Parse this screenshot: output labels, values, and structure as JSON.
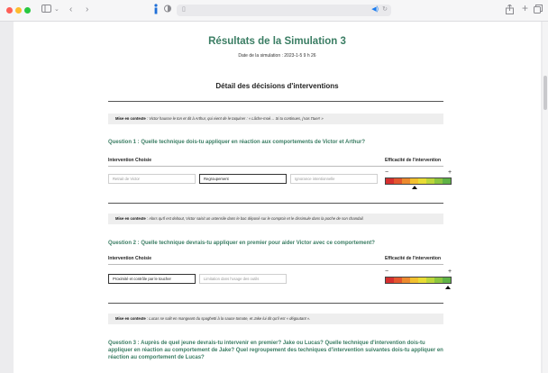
{
  "browser": {
    "url": "",
    "icons": {
      "sidebar": "sidebar-icon",
      "back": "chevron-left-icon",
      "forward": "chevron-right-icon",
      "share": "share-icon",
      "new_tab": "plus-icon",
      "tabs": "tabs-icon"
    }
  },
  "page": {
    "title": "Résultats de la Simulation 3",
    "date": "Date de la simulation : 2023-1-5 9 h 26",
    "section_title": "Détail des décisions d'interventions"
  },
  "labels": {
    "chosen_intervention": "Intervention Choisie",
    "efficacy": "Efficacité de l'intervention",
    "minus": "−",
    "plus": "+"
  },
  "questions": [
    {
      "context_label": "Mise en contexte",
      "context_text": " : Victor hausse le ton et dit à Arthur, qui vient de le taquiner : « Lâche-moé… Si tu continues, j'vas t'tuer! »",
      "question": "Question 1 : Quelle technique dois-tu appliquer en réaction aux comportements de Victor et Arthur?",
      "choices": [
        {
          "label": "Retrait de Victor",
          "selected": false
        },
        {
          "label": "Regroupement",
          "selected": true
        },
        {
          "label": "Ignorance intentionnelle",
          "selected": false
        }
      ],
      "efficacy": 0.45
    },
    {
      "context_label": "Mise en contexte",
      "context_text": " : Alors qu'il est debout, Victor saisit un ustensile dans le bac déposé sur le comptoir et le dissimule dans la poche de son chandail.",
      "question": "Question 2 : Quelle technique devrais-tu appliquer en premier pour aider Victor avec ce comportement?",
      "choices": [
        {
          "label": "Proximité et contrôle par le toucher",
          "selected": true
        },
        {
          "label": "Limitation dans l'usage des outils",
          "selected": false
        }
      ],
      "efficacy": 0.95
    },
    {
      "context_label": "Mise en contexte",
      "context_text": " : Lucas se salit en mangeant du spaghetti à la sauce tomate, et Jake lui dit qu'il est « dégoutant ».",
      "question": "Question 3 : Auprès de quel jeune devrais-tu intervenir en premier? Jake ou Lucas? Quelle technique d'intervention dois-tu appliquer en réaction au comportement de Jake? Quel regroupement des techniques d'intervention suivantes dois-tu appliquer en réaction au comportement de Lucas?"
    }
  ],
  "gauge_colors": [
    "#d62f2f",
    "#e4562e",
    "#ec8a2e",
    "#f2c02f",
    "#e9dc35",
    "#bcd63a",
    "#8cc63f",
    "#5fb246"
  ]
}
